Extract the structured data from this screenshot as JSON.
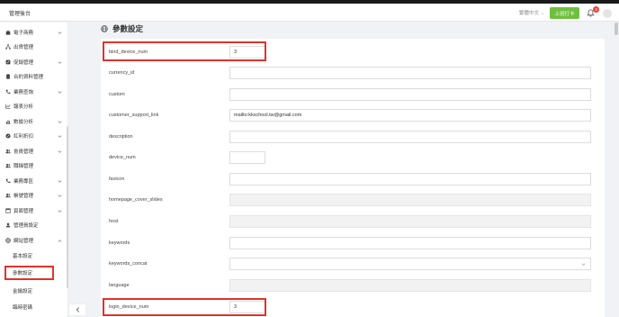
{
  "app": {
    "title": "管理後台"
  },
  "header": {
    "language": "繁體中文",
    "clock_label": "上班打卡",
    "notification_count": "3"
  },
  "sidebar": {
    "items": [
      {
        "label": "電子商務",
        "icon": "bag-icon",
        "chevron": true
      },
      {
        "label": "出貨管理",
        "icon": "sitemap-icon",
        "chevron": false
      },
      {
        "label": "促銷管理",
        "icon": "promo-icon",
        "chevron": true
      },
      {
        "label": "合約資料管理",
        "icon": "contract-icon",
        "chevron": false
      },
      {
        "label": "業務查詢",
        "icon": "phone-icon",
        "chevron": true
      },
      {
        "label": "報表分析",
        "icon": "chart-icon",
        "chevron": false
      },
      {
        "label": "數據分析",
        "icon": "bar-chart-icon",
        "chevron": true
      },
      {
        "label": "紅利折扣",
        "icon": "gift-icon",
        "chevron": true
      },
      {
        "label": "會員管理",
        "icon": "users-icon",
        "chevron": true
      },
      {
        "label": "職稱管理",
        "icon": "users-icon",
        "chevron": false
      },
      {
        "label": "業務專區",
        "icon": "phone-icon",
        "chevron": true
      },
      {
        "label": "帳號管理",
        "icon": "users-icon",
        "chevron": true
      },
      {
        "label": "頁面管理",
        "icon": "page-icon",
        "chevron": true
      },
      {
        "label": "管理員設定",
        "icon": "user-icon",
        "chevron": false
      },
      {
        "label": "網站管理",
        "icon": "globe-icon",
        "chevron": true,
        "expanded": true
      }
    ],
    "sub_items": [
      {
        "label": "基本設定"
      },
      {
        "label": "參數設定",
        "active": true
      },
      {
        "label": "金鑰設定"
      },
      {
        "label": "臨時密碼"
      }
    ]
  },
  "page": {
    "title": "參數設定"
  },
  "form": {
    "rows": [
      {
        "label": "bind_device_num",
        "value": "3",
        "type": "short",
        "highlight": true
      },
      {
        "label": "currency_id",
        "value": "",
        "type": "text"
      },
      {
        "label": "custom",
        "value": "",
        "type": "text"
      },
      {
        "label": "customer_support_link",
        "value": "mailto:kkschool.tw@gmail.com",
        "type": "text"
      },
      {
        "label": "description",
        "value": "",
        "type": "text"
      },
      {
        "label": "device_num",
        "value": "",
        "type": "short"
      },
      {
        "label": "favicon",
        "value": "",
        "type": "text"
      },
      {
        "label": "homepage_cover_slides",
        "value": "",
        "type": "disabled"
      },
      {
        "label": "host",
        "value": "",
        "type": "disabled"
      },
      {
        "label": "keywords",
        "value": "",
        "type": "text"
      },
      {
        "label": "keywords_concat",
        "value": "",
        "type": "select"
      },
      {
        "label": "language",
        "value": "",
        "type": "disabled"
      },
      {
        "label": "login_device_num",
        "value": "3",
        "type": "short",
        "highlight": true
      }
    ]
  },
  "colors": {
    "accent_green": "#6fbf3f",
    "highlight_red": "#e0322b",
    "badge_red": "#f04134"
  }
}
